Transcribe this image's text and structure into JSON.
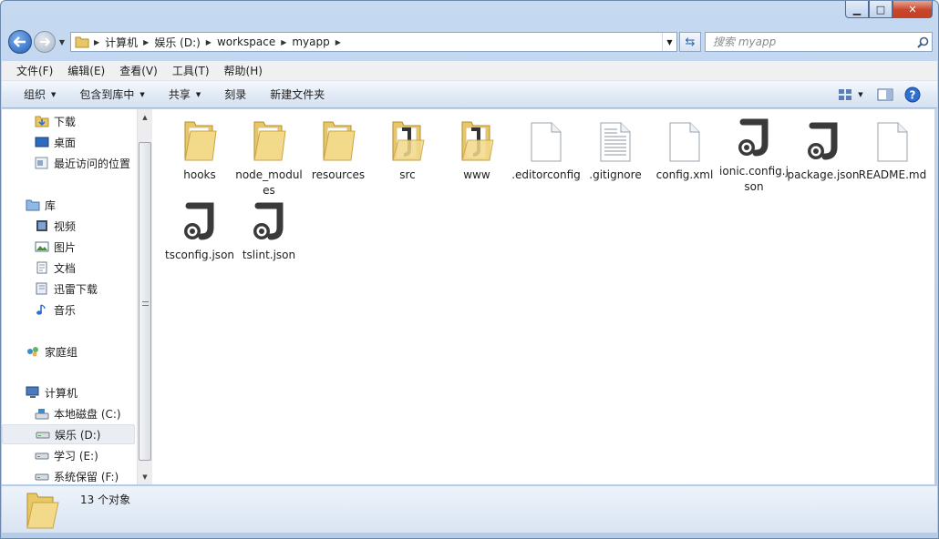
{
  "window": {
    "controls": {
      "minimize": "▁",
      "maximize": "□",
      "close": "✕"
    }
  },
  "address": {
    "crumbs": [
      "计算机",
      "娱乐 (D:)",
      "workspace",
      "myapp"
    ],
    "search_placeholder": "搜索 myapp"
  },
  "menu": {
    "items": [
      "文件(F)",
      "编辑(E)",
      "查看(V)",
      "工具(T)",
      "帮助(H)"
    ]
  },
  "toolbar": {
    "organize": "组织",
    "include_in_library": "包含到库中",
    "share": "共享",
    "burn": "刻录",
    "new_folder": "新建文件夹"
  },
  "nav": {
    "items": [
      {
        "label": "下载",
        "icon": "download-folder-icon"
      },
      {
        "label": "桌面",
        "icon": "desktop-icon"
      },
      {
        "label": "最近访问的位置",
        "icon": "recent-places-icon"
      },
      {
        "label": "库",
        "icon": "libraries-icon"
      },
      {
        "label": "视频",
        "icon": "videos-icon"
      },
      {
        "label": "图片",
        "icon": "pictures-icon"
      },
      {
        "label": "文档",
        "icon": "documents-icon"
      },
      {
        "label": "迅雷下载",
        "icon": "thunder-download-icon"
      },
      {
        "label": "音乐",
        "icon": "music-icon"
      },
      {
        "label": "家庭组",
        "icon": "homegroup-icon"
      },
      {
        "label": "计算机",
        "icon": "computer-icon"
      },
      {
        "label": "本地磁盘 (C:)",
        "icon": "system-drive-icon"
      },
      {
        "label": "娱乐 (D:)",
        "icon": "drive-icon"
      },
      {
        "label": "学习 (E:)",
        "icon": "drive-icon"
      },
      {
        "label": "系统保留 (F:)",
        "icon": "drive-icon"
      }
    ]
  },
  "files": [
    {
      "name": "hooks",
      "type": "folder"
    },
    {
      "name": "node_modules",
      "type": "folder"
    },
    {
      "name": "resources",
      "type": "folder"
    },
    {
      "name": "src",
      "type": "folder-json"
    },
    {
      "name": "www",
      "type": "folder-json"
    },
    {
      "name": ".editorconfig",
      "type": "blank-file"
    },
    {
      "name": ".gitignore",
      "type": "text-file"
    },
    {
      "name": "config.xml",
      "type": "blank-file"
    },
    {
      "name": "ionic.config.json",
      "type": "json-file"
    },
    {
      "name": "package.json",
      "type": "json-file"
    },
    {
      "name": "README.md",
      "type": "blank-file"
    },
    {
      "name": "tsconfig.json",
      "type": "json-file"
    },
    {
      "name": "tslint.json",
      "type": "json-file"
    }
  ],
  "status": {
    "count_text": "13 个对象"
  },
  "colors": {
    "selection": "#eaeef4",
    "toolbar": "#dbe6f3",
    "frame": "#c5d9f1"
  }
}
